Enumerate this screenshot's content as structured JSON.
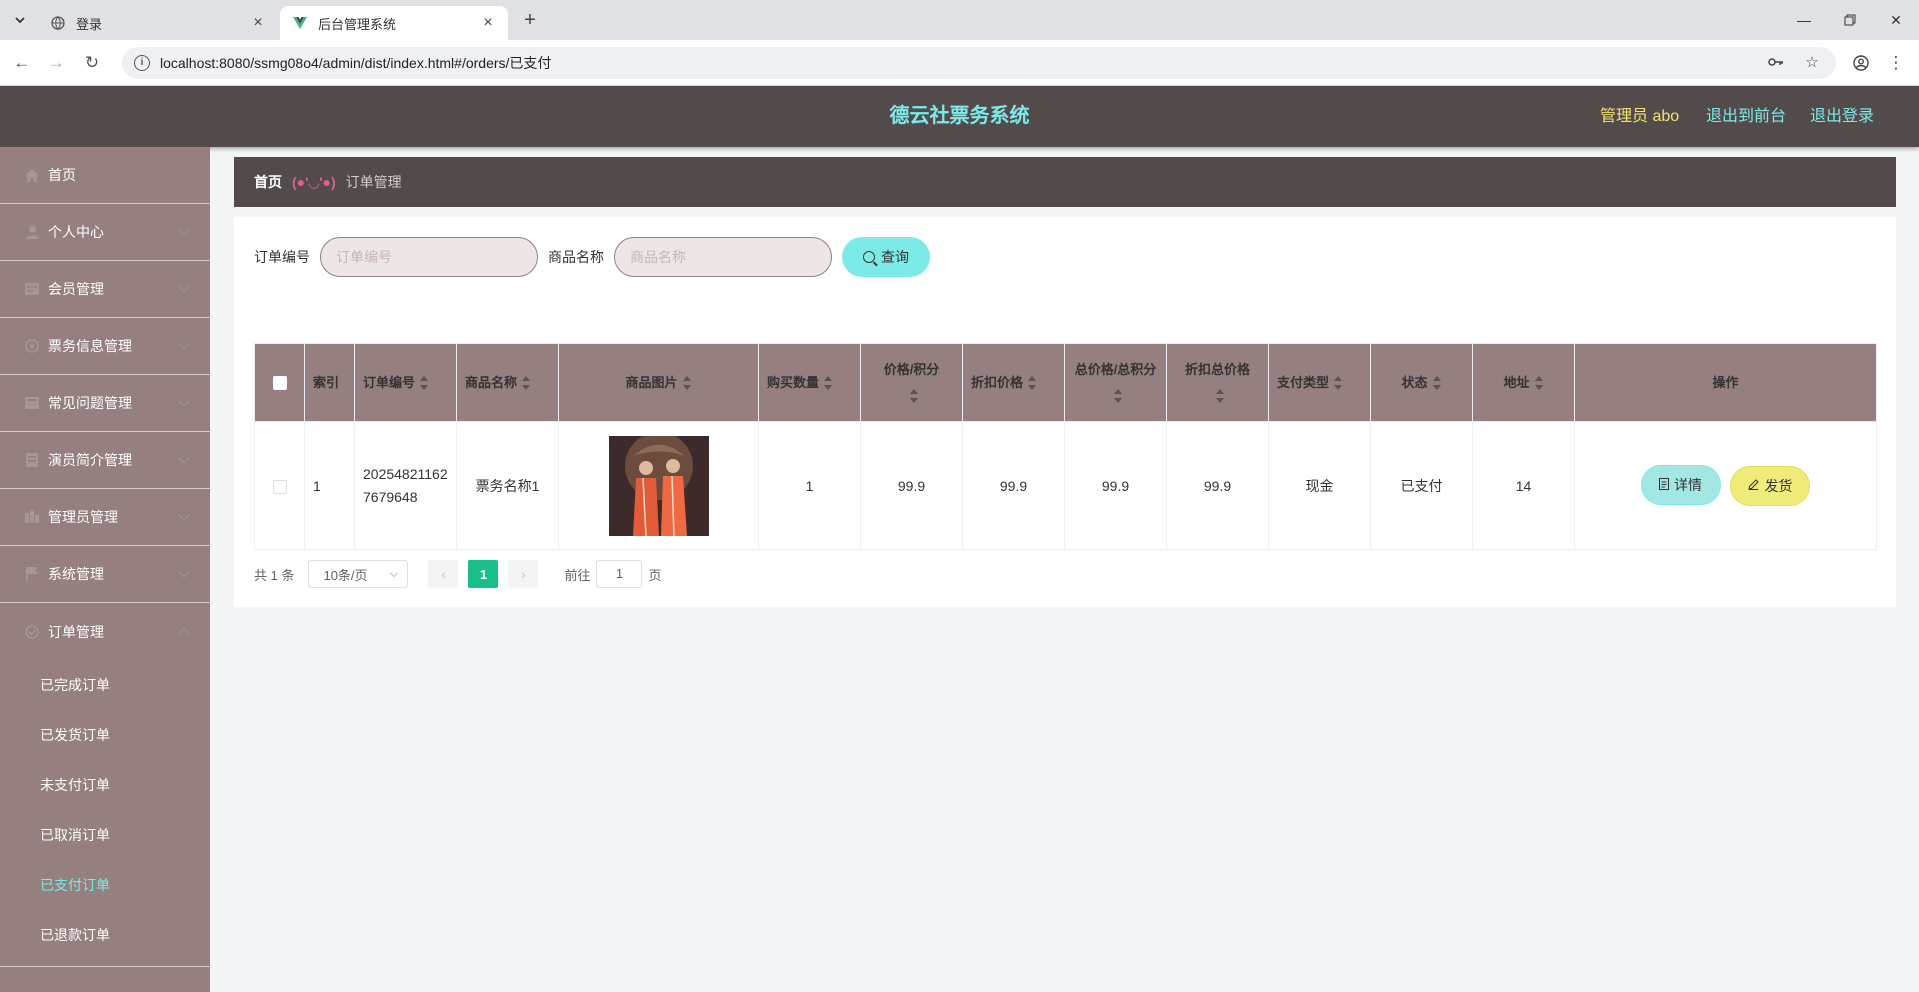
{
  "browser": {
    "tabs": [
      {
        "title": "登录",
        "active": false
      },
      {
        "title": "后台管理系统",
        "active": true
      }
    ],
    "url": "localhost:8080/ssmg08o4/admin/dist/index.html#/orders/已支付"
  },
  "header": {
    "title": "德云社票务系统",
    "user": "管理员 abo",
    "front": "退出到前台",
    "logout": "退出登录"
  },
  "sidebar": {
    "items": [
      {
        "label": "首页",
        "icon": "home-icon"
      },
      {
        "label": "个人中心",
        "icon": "user-icon"
      },
      {
        "label": "会员管理",
        "icon": "member-icon"
      },
      {
        "label": "票务信息管理",
        "icon": "ticket-icon"
      },
      {
        "label": "常见问题管理",
        "icon": "question-icon"
      },
      {
        "label": "演员简介管理",
        "icon": "actor-icon"
      },
      {
        "label": "管理员管理",
        "icon": "admin-icon"
      },
      {
        "label": "系统管理",
        "icon": "flag-icon"
      },
      {
        "label": "订单管理",
        "icon": "order-icon"
      }
    ],
    "sub": [
      "已完成订单",
      "已发货订单",
      "未支付订单",
      "已取消订单",
      "已支付订单",
      "已退款订单"
    ],
    "active_sub": "已支付订单"
  },
  "breadcrumb": {
    "home": "首页",
    "sep": "(●'◡'●)",
    "current": "订单管理"
  },
  "search": {
    "order_label": "订单编号",
    "order_placeholder": "订单编号",
    "product_label": "商品名称",
    "product_placeholder": "商品名称",
    "button": "查询"
  },
  "table": {
    "headers": [
      "索引",
      "订单编号",
      "商品名称",
      "商品图片",
      "购买数量",
      "价格/积分",
      "折扣价格",
      "总价格/总积分",
      "折扣总价格",
      "支付类型",
      "状态",
      "地址",
      "操作"
    ],
    "rows": [
      {
        "index": "1",
        "order_no": "202548211627679648",
        "product": "票务名称1",
        "qty": "1",
        "price": "99.9",
        "discount_price": "99.9",
        "total": "99.9",
        "discount_total": "99.9",
        "pay_type": "现金",
        "status": "已支付",
        "address": "14",
        "detail_label": "详情",
        "ship_label": "发货"
      }
    ]
  },
  "pager": {
    "total": "共 1 条",
    "size": "10条/页",
    "page": "1",
    "goto": "前往",
    "goto_value": "1",
    "page_suffix": "页"
  }
}
